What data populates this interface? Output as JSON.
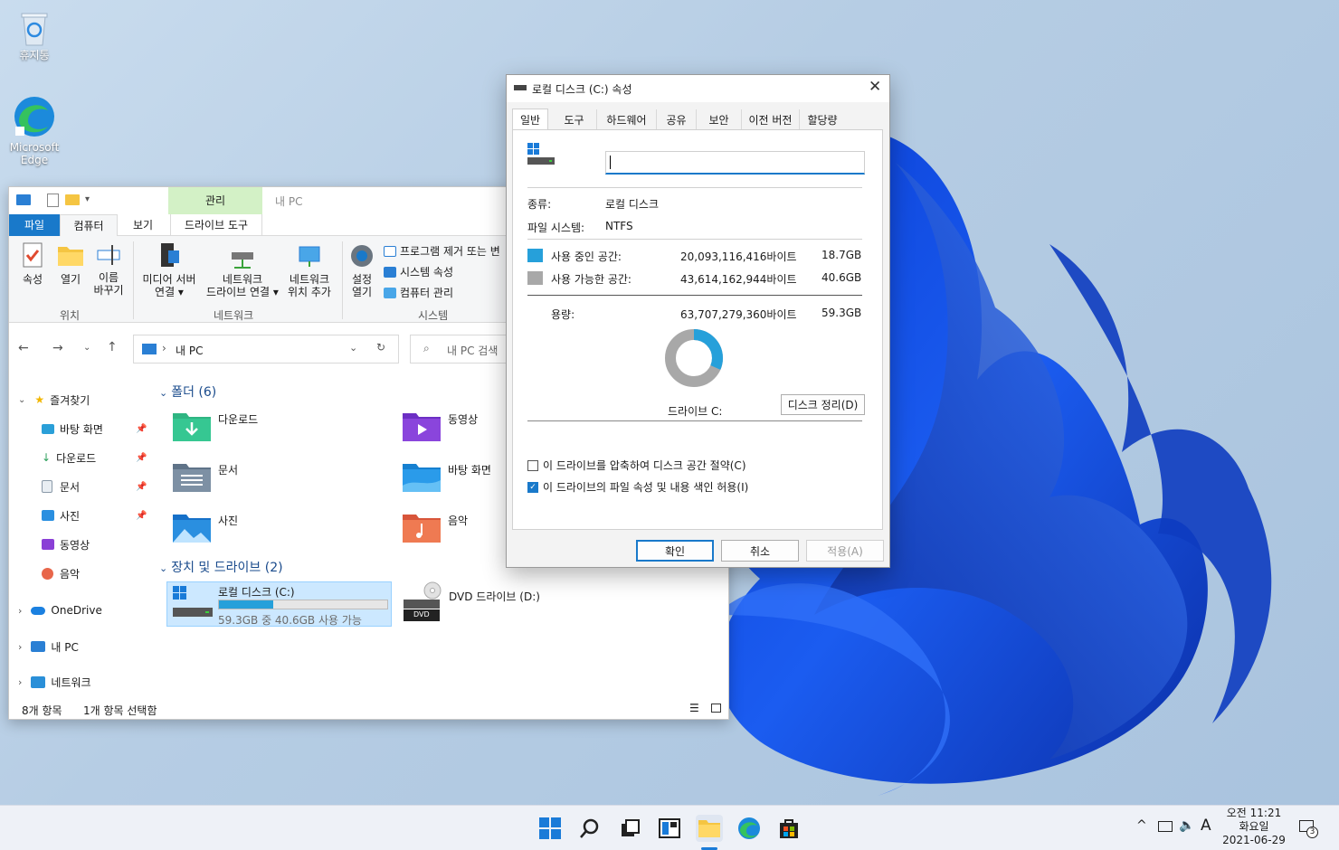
{
  "desktop": {
    "recycle_bin": "휴지통",
    "edge_line1": "Microsoft",
    "edge_line2": "Edge"
  },
  "explorer": {
    "contextual_group": "관리",
    "title": "내 PC",
    "tabs": [
      "파일",
      "컴퓨터",
      "보기",
      "드라이브 도구"
    ],
    "ribbon": {
      "location": {
        "group": "위치",
        "items": [
          "속성",
          "열기",
          "이름",
          "바꾸기"
        ]
      },
      "network": {
        "group": "네트워크",
        "media1": "미디어 서버",
        "media2": "연결 ▾",
        "netdrv1": "네트워크",
        "netdrv2": "드라이브 연결 ▾",
        "netloc1": "네트워크",
        "netloc2": "위치 추가"
      },
      "system": {
        "group": "시스템",
        "settings1": "설정",
        "settings2": "열기",
        "uninstall": "프로그램 제거 또는 변",
        "sysprops": "시스템 속성",
        "manage": "컴퓨터 관리"
      }
    },
    "address": "내 PC",
    "search_placeholder": "내 PC 검색",
    "nav": {
      "quick": "즐겨찾기",
      "items": [
        "바탕 화면",
        "다운로드",
        "문서",
        "사진",
        "동영상",
        "음악"
      ],
      "onedrive": "OneDrive",
      "thispc": "내 PC",
      "network": "네트워크"
    },
    "folders_header": "폴더 (6)",
    "folders": [
      "다운로드",
      "동영상",
      "문서",
      "바탕 화면",
      "사진",
      "음악"
    ],
    "drives_header": "장치 및 드라이브 (2)",
    "drive_c": {
      "name": "로컬 디스크 (C:)",
      "info": "59.3GB 중 40.6GB 사용 가능",
      "used_fraction": 0.32
    },
    "drive_d": {
      "name": "DVD 드라이브 (D:)",
      "badge": "DVD"
    },
    "status_items": "8개 항목",
    "status_selected": "1개 항목 선택함"
  },
  "props": {
    "title": "로컬 디스크 (C:) 속성",
    "tabs": [
      "일반",
      "도구",
      "하드웨어",
      "공유",
      "보안",
      "이전 버전",
      "할당량"
    ],
    "name_value": "",
    "type_label": "종류:",
    "type_value": "로컬 디스크",
    "fs_label": "파일 시스템:",
    "fs_value": "NTFS",
    "used_label": "사용 중인 공간:",
    "used_bytes": "20,093,116,416바이트",
    "used_gb": "18.7GB",
    "free_label": "사용 가능한 공간:",
    "free_bytes": "43,614,162,944바이트",
    "free_gb": "40.6GB",
    "cap_label": "용량:",
    "cap_bytes": "63,707,279,360바이트",
    "cap_gb": "59.3GB",
    "drive_label": "드라이브 C:",
    "cleanup": "디스크 정리(D)",
    "compress": "이 드라이브를 압축하여 디스크 공간 절약(C)",
    "index": "이 드라이브의 파일 속성 및 내용 색인 허용(I)",
    "ok": "확인",
    "cancel": "취소",
    "apply": "적용(A)",
    "used_color": "#26a0da",
    "free_color": "#a8a8a8",
    "used_fraction": 0.3154
  },
  "taskbar": {
    "ampm_time": "오전 11:21",
    "weekday": "화요일",
    "date": "2021-06-29",
    "ime": "A",
    "notif_count": "3"
  }
}
